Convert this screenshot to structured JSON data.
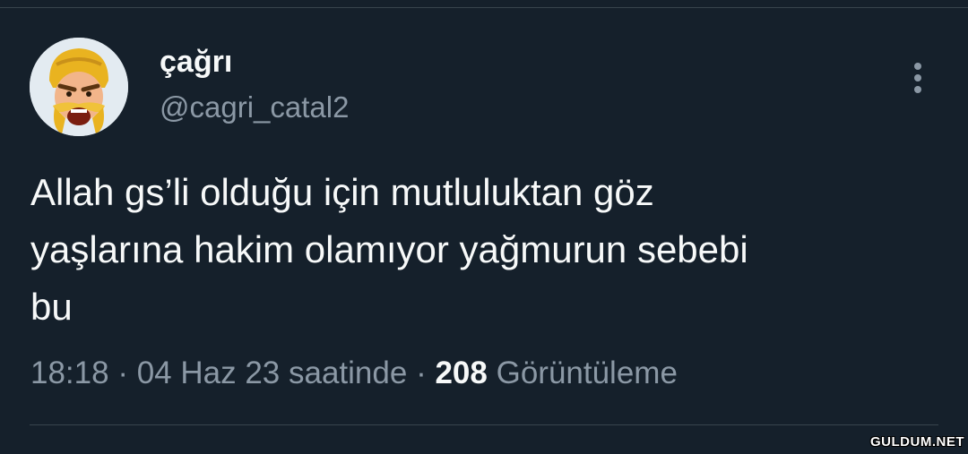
{
  "tweet": {
    "author": {
      "display_name": "çağrı",
      "handle": "@cagri_catal2",
      "avatar_icon": "clash-barbarian-avatar"
    },
    "text": "Allah gs’li olduğu için mutluluktan göz\nyaşlarına hakim olamıyor yağmurun sebebi\nbu",
    "time": "18:18",
    "date": "04 Haz 23 saatinde",
    "separator": "·",
    "views_count": "208",
    "views_label": "Görüntüleme",
    "more_icon": "more-vertical-icon"
  },
  "watermark": "GULDUM.NET",
  "colors": {
    "background": "#15202b",
    "primary_text": "#f7f9f9",
    "secondary_text": "#8b98a5",
    "divider": "#38444d"
  }
}
